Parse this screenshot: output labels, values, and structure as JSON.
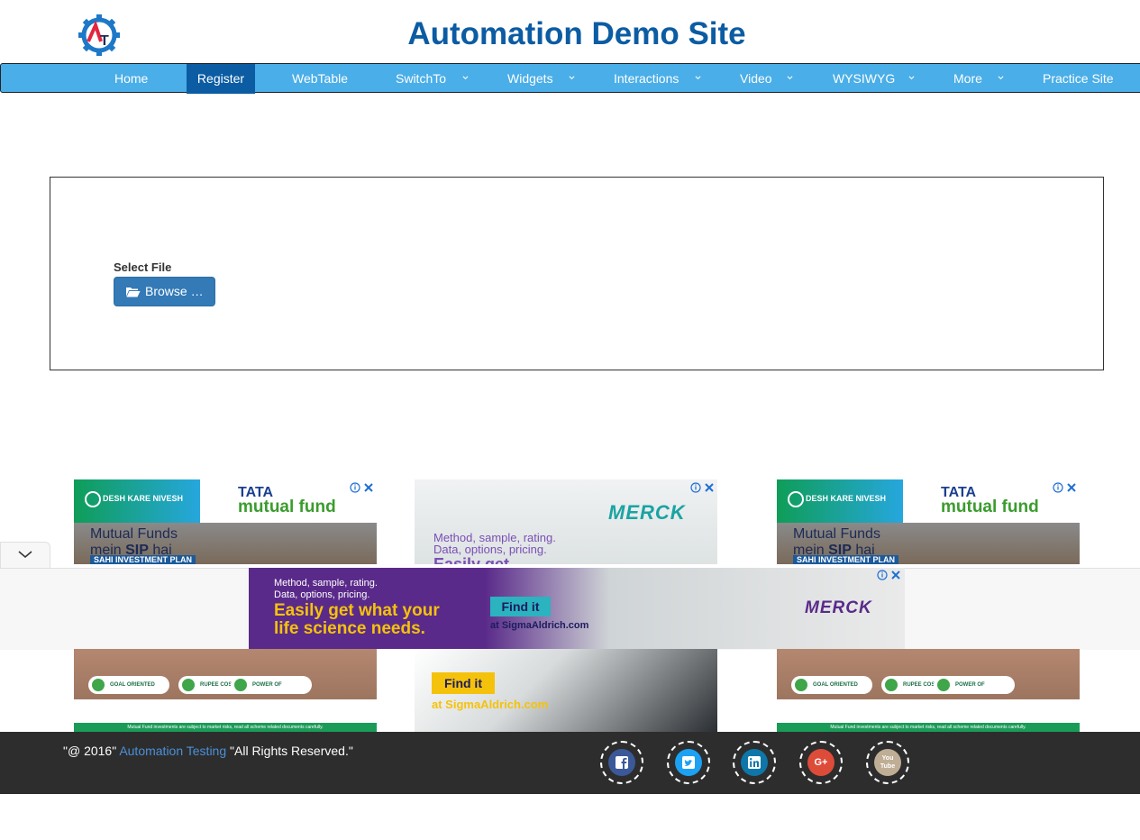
{
  "header": {
    "title": "Automation Demo Site",
    "logo_text": "AT"
  },
  "nav": {
    "items": [
      {
        "label": "Home",
        "dropdown": false,
        "active": false
      },
      {
        "label": "Register",
        "dropdown": false,
        "active": true
      },
      {
        "label": "WebTable",
        "dropdown": false,
        "active": false
      },
      {
        "label": "SwitchTo",
        "dropdown": true,
        "active": false
      },
      {
        "label": "Widgets",
        "dropdown": true,
        "active": false
      },
      {
        "label": "Interactions",
        "dropdown": true,
        "active": false
      },
      {
        "label": "Video",
        "dropdown": true,
        "active": false
      },
      {
        "label": "WYSIWYG",
        "dropdown": true,
        "active": false
      },
      {
        "label": "More",
        "dropdown": true,
        "active": false
      },
      {
        "label": "Practice Site",
        "dropdown": false,
        "active": false
      }
    ],
    "colors": {
      "bar": "#4aaee8",
      "active": "#0b5ca3"
    }
  },
  "upload": {
    "label": "Select File",
    "button_label": "Browse …",
    "button_icon": "folder-open-icon"
  },
  "ads": {
    "tata": {
      "banner": "DESH KARE NIVESH",
      "brand_top": "TATA",
      "brand_bottom": "mutual fund",
      "headline_1": "Mutual Funds",
      "headline_2_pre": "mein ",
      "headline_2_bold": "SIP",
      "headline_2_post": " hai",
      "tagline": "SAHI INVESTMENT PLAN",
      "pill_1": "GOAL ORIENTED INVESTING",
      "pill_2": "RUPEE COST AVERAGING",
      "pill_3": "POWER OF COMPOUNDING",
      "footer": "Mutual Fund investments are subject to market risks, read all scheme related documents carefully."
    },
    "merck": {
      "logo": "MERCK",
      "line_1": "Method, sample, rating.",
      "line_2": "Data, options, pricing.",
      "line_3_partial": "Easily get",
      "headline": "Easily get what your",
      "headline_2": "life science needs.",
      "cta": "Find it",
      "site": "at SigmaAldrich.com"
    }
  },
  "footer": {
    "copy_pre": "\"@ 2016\" ",
    "copy_link": "Automation Testing",
    "copy_post": " \"All Rights Reserved.\"",
    "social": [
      {
        "name": "facebook-icon",
        "glyph": "f",
        "color": "#3b5998"
      },
      {
        "name": "twitter-icon",
        "glyph": "t",
        "color": "#1da1f2"
      },
      {
        "name": "linkedin-icon",
        "glyph": "in",
        "color": "#0e76a8"
      },
      {
        "name": "google-plus-icon",
        "glyph": "G+",
        "color": "#dd4b39"
      },
      {
        "name": "youtube-icon",
        "glyph": "You Tube",
        "color": "#bfae95"
      }
    ]
  }
}
